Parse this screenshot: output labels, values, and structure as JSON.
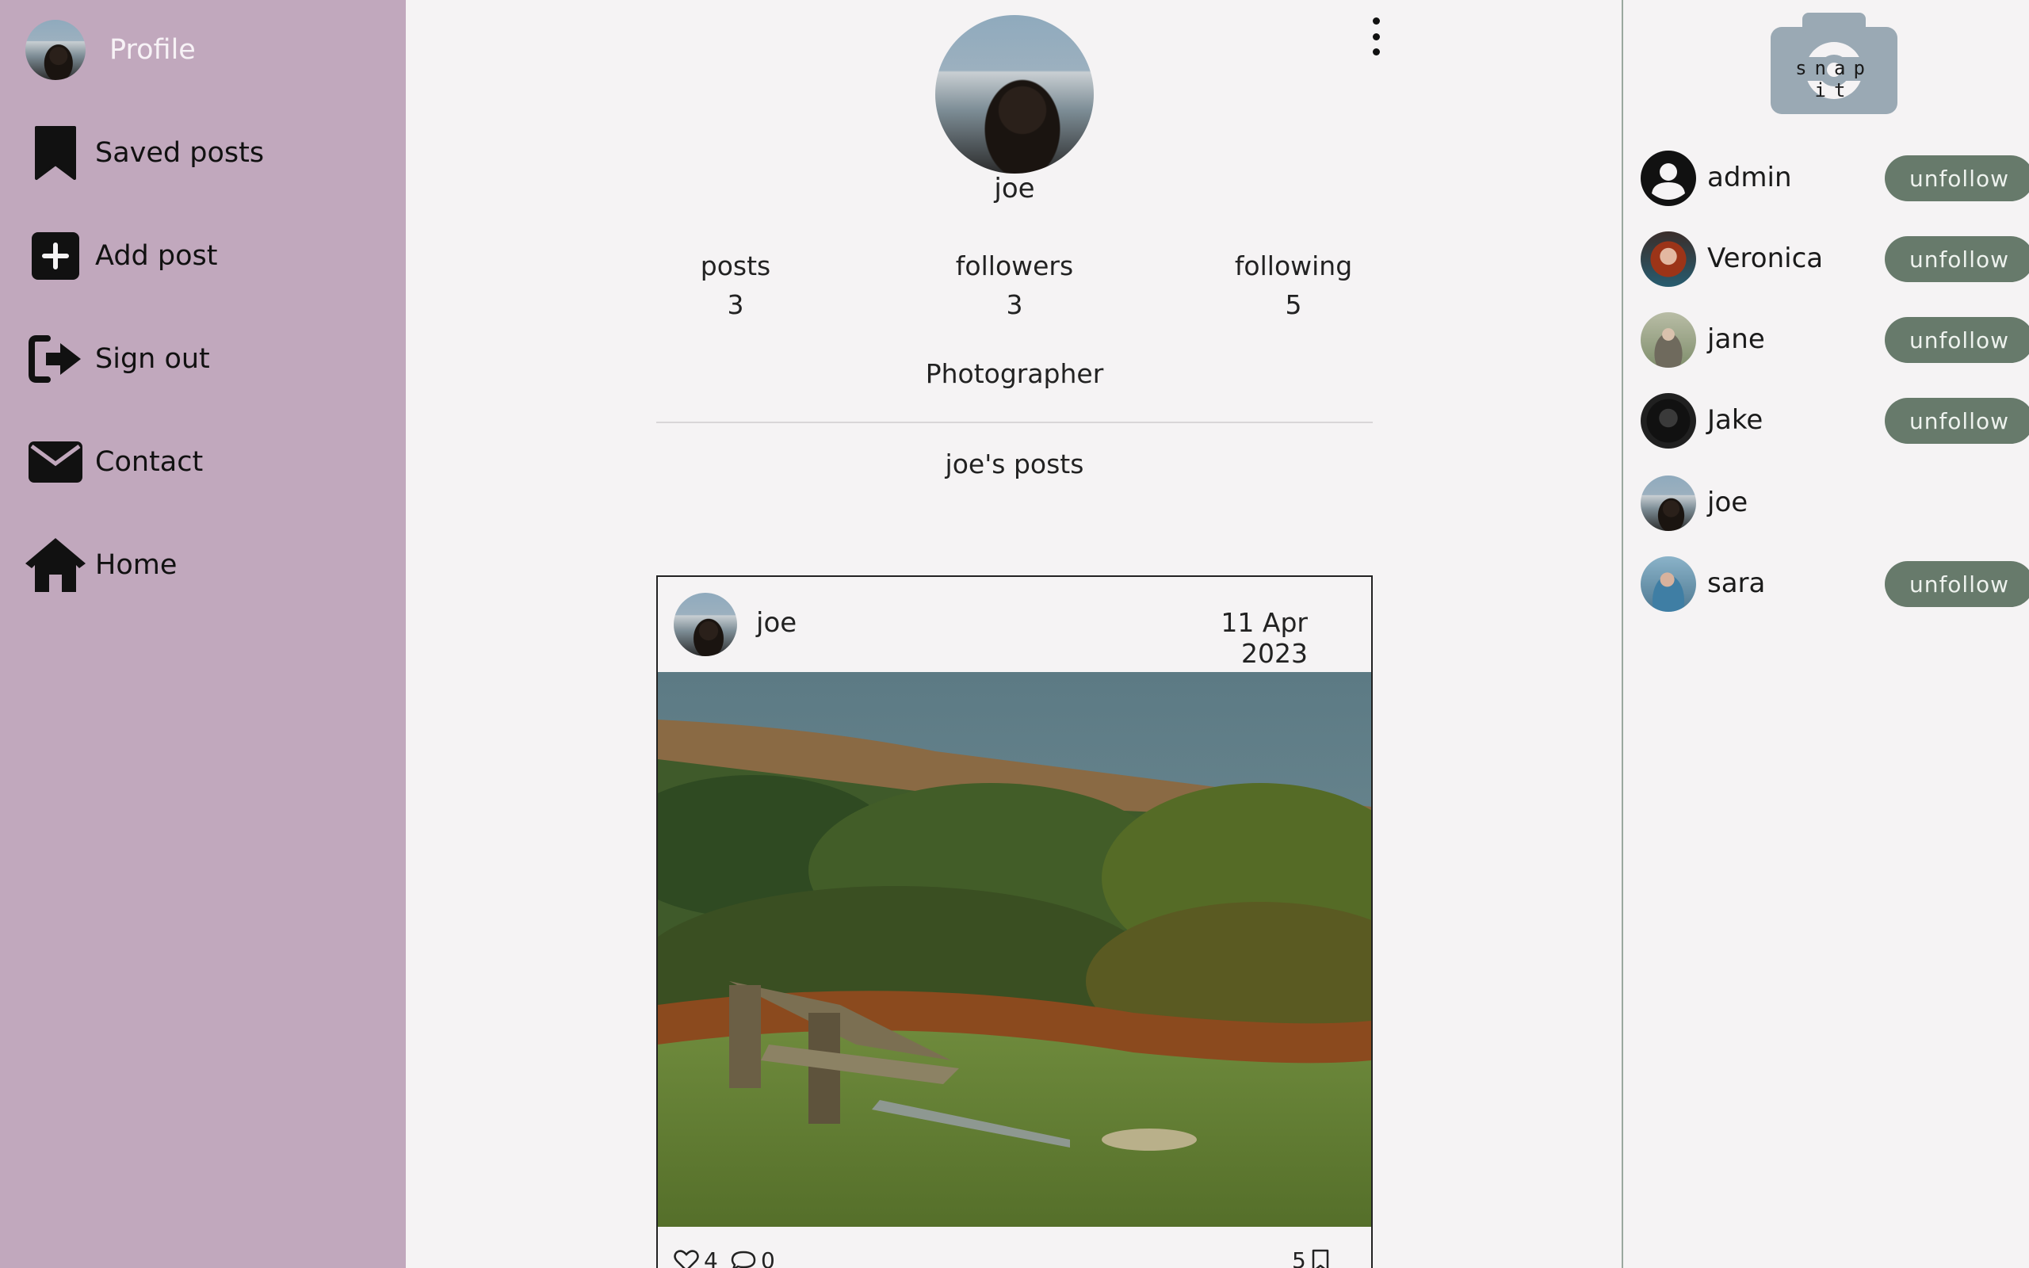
{
  "sidebar": {
    "items": [
      {
        "label": "Profile",
        "icon": "avatar"
      },
      {
        "label": "Saved posts",
        "icon": "bookmark-icon"
      },
      {
        "label": "Add post",
        "icon": "plus-square-icon"
      },
      {
        "label": "Sign out",
        "icon": "sign-out-icon"
      },
      {
        "label": "Contact",
        "icon": "envelope-icon"
      },
      {
        "label": "Home",
        "icon": "home-icon"
      }
    ]
  },
  "profile": {
    "name": "joe",
    "stats": {
      "posts_label": "posts",
      "posts": "3",
      "followers_label": "followers",
      "followers": "3",
      "following_label": "following",
      "following": "5"
    },
    "bio": "Photographer",
    "posts_heading": "joe's posts"
  },
  "post": {
    "user": "joe",
    "date": "11 Apr 2023",
    "likes": "4",
    "comments": "0",
    "saves": "5"
  },
  "logo": {
    "text": "snap it"
  },
  "following": [
    {
      "name": "admin",
      "button": "unfollow"
    },
    {
      "name": "Veronica",
      "button": "unfollow"
    },
    {
      "name": "jane",
      "button": "unfollow"
    },
    {
      "name": "Jake",
      "button": "unfollow"
    },
    {
      "name": "joe",
      "button": ""
    },
    {
      "name": "sara",
      "button": "unfollow"
    }
  ],
  "colors": {
    "sidebar_bg": "#c1a8bd",
    "page_bg": "#f5f3f4",
    "button_bg": "#677a6b",
    "logo": "#9aa9b4"
  }
}
